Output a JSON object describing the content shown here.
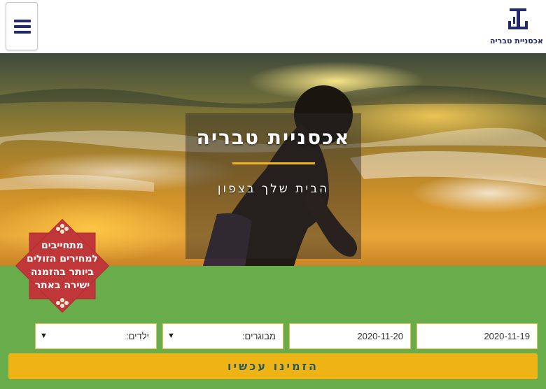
{
  "header": {
    "logo_text": "אכסניית טבריה",
    "menu_icon": "hamburger-menu-icon"
  },
  "hero": {
    "title": "אכסניית טבריה",
    "subtitle": "הבית שלך בצפון"
  },
  "badge": {
    "lines": [
      "מתחייבים",
      "למחירים הזולים",
      "ביותר בהזמנה",
      "ישירה באתר"
    ],
    "color": "#c0373a",
    "icon": "flower-ornament-icon"
  },
  "booking": {
    "checkin": "2020-11-19",
    "checkout": "2020-11-20",
    "adults_label": "מבוגרים:",
    "children_label": "ילדים:",
    "submit_label": "הזמינו עכשיו",
    "background": "#68ac4c",
    "button_color": "#eeb416"
  }
}
